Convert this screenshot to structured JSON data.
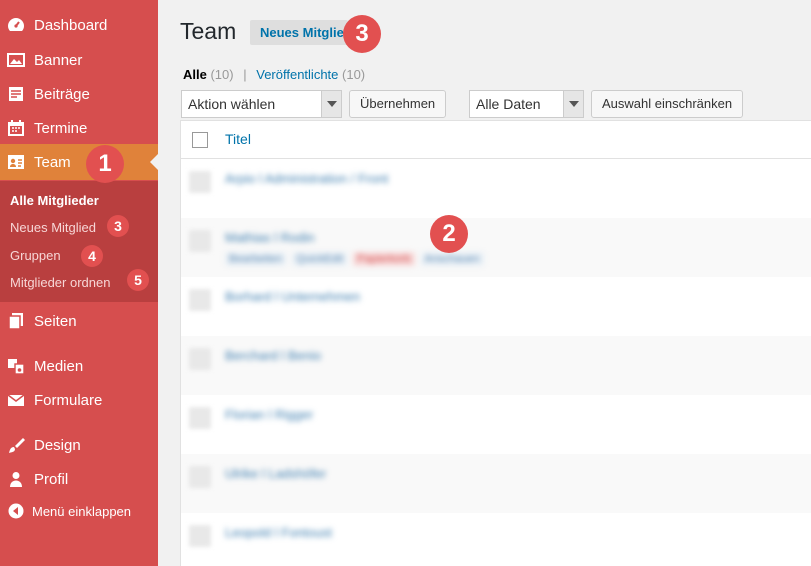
{
  "sidebar": {
    "items": [
      {
        "label": "Dashboard",
        "icon": "dashboard-icon"
      },
      {
        "label": "Banner",
        "icon": "banner-icon"
      },
      {
        "label": "Beiträge",
        "icon": "posts-icon"
      },
      {
        "label": "Termine",
        "icon": "calendar-icon"
      },
      {
        "label": "Team",
        "icon": "team-icon"
      },
      {
        "label": "Seiten",
        "icon": "pages-icon"
      },
      {
        "label": "Medien",
        "icon": "media-icon"
      },
      {
        "label": "Formulare",
        "icon": "mail-icon"
      },
      {
        "label": "Design",
        "icon": "brush-icon"
      },
      {
        "label": "Profil",
        "icon": "user-icon"
      }
    ],
    "submenu": [
      "Alle Mitglieder",
      "Neues Mitglied",
      "Gruppen",
      "Mitglieder ordnen"
    ],
    "collapse_label": "Menü einklappen"
  },
  "callouts": {
    "n1": "1",
    "n2": "2",
    "n3": "3",
    "n4": "4",
    "n5": "5"
  },
  "header": {
    "title": "Team",
    "add_new": "Neues Mitglied"
  },
  "filters": {
    "all_label": "Alle",
    "all_count": "(10)",
    "separator": "|",
    "published_label": "Veröffentlichte",
    "published_count": "(10)"
  },
  "toolbar": {
    "bulk_action": "Aktion wählen",
    "apply": "Übernehmen",
    "dates": "Alle Daten",
    "filter": "Auswahl einschränken"
  },
  "table": {
    "title_header": "Titel",
    "rows": [
      {
        "title": "Arpio l Administration / Front"
      },
      {
        "title": "Mathias l Rodin",
        "actions": [
          "Bearbeiten",
          "QuickEdit",
          "Papierkorb",
          "Anschauen"
        ]
      },
      {
        "title": "Borhard l Unternehmen"
      },
      {
        "title": "Berchard l Benio"
      },
      {
        "title": "Florian l Rigger"
      },
      {
        "title": "Ulrike l Ladshöfer"
      },
      {
        "title": "Leopold l Fontoust"
      }
    ]
  },
  "colors": {
    "sidebar": "#d64e4e",
    "active": "#e0823a",
    "submenu": "#b93f3f",
    "badge": "#e25050",
    "link": "#0073aa"
  }
}
